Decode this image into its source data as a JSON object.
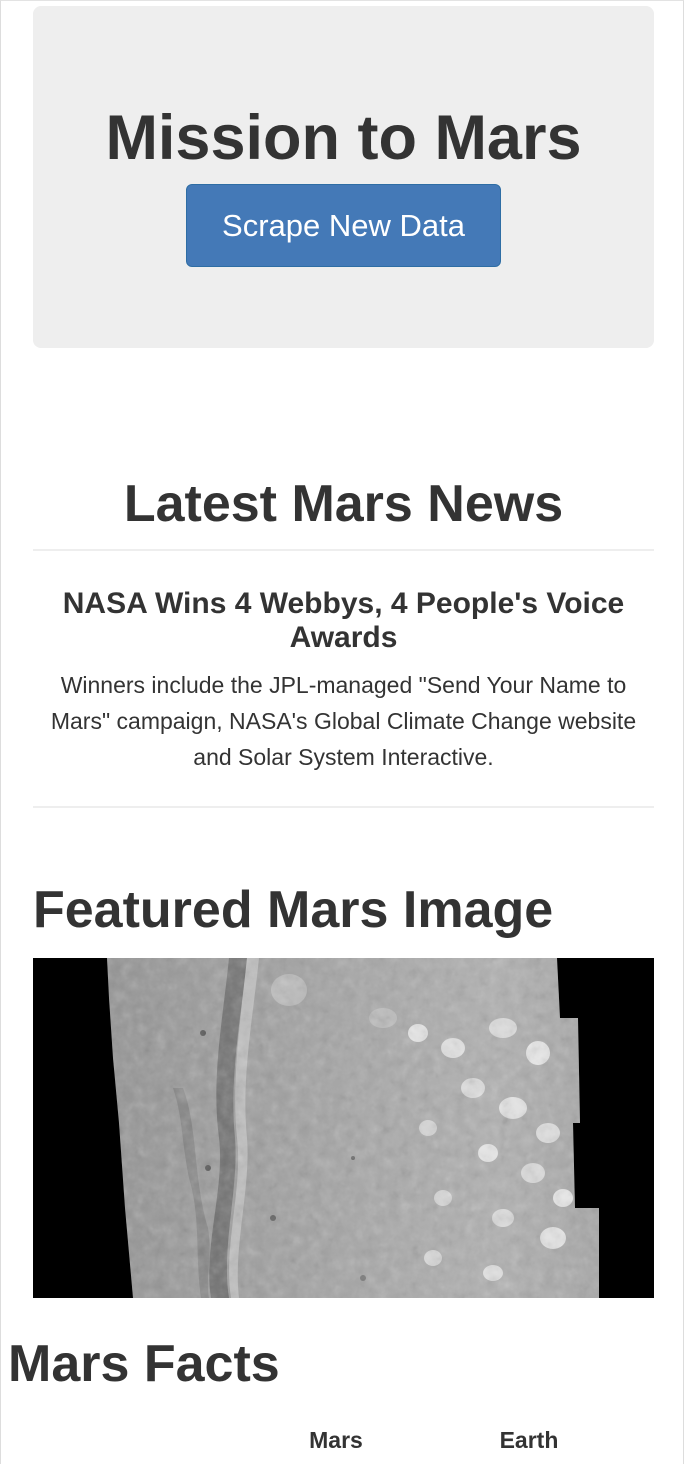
{
  "jumbotron": {
    "title": "Mission to Mars",
    "button_label": "Scrape New Data"
  },
  "news": {
    "heading": "Latest Mars News",
    "title": "NASA Wins 4 Webbys, 4 People's Voice Awards",
    "teaser": "Winners include the JPL-managed \"Send Your Name to Mars\" campaign, NASA's Global Climate Change website and Solar System Interactive."
  },
  "featured": {
    "heading": "Featured Mars Image"
  },
  "facts": {
    "heading": "Mars Facts",
    "columns": [
      "",
      "Mars",
      "Earth"
    ]
  },
  "colors": {
    "button": "#4479b7",
    "jumbotron_bg": "#eeeeee",
    "text": "#333333"
  }
}
